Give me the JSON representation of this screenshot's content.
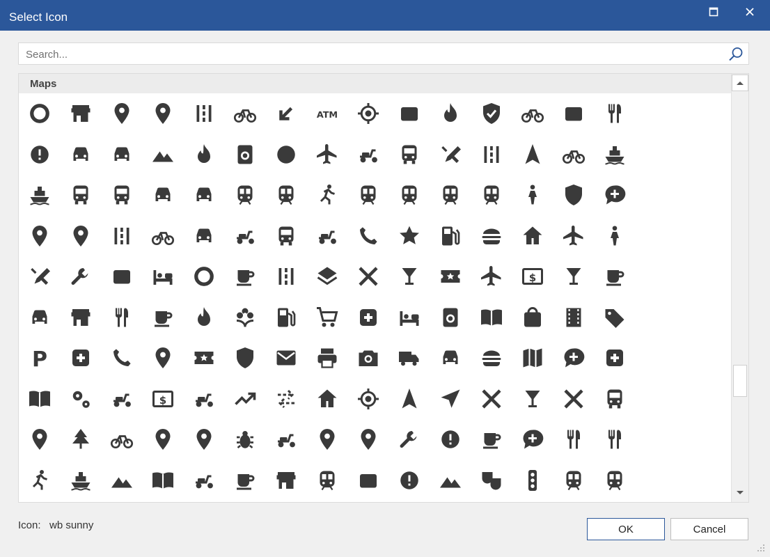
{
  "window": {
    "title": "Select Icon",
    "accent": "#2b579a"
  },
  "search": {
    "placeholder": "Search..."
  },
  "section": {
    "label": "Maps"
  },
  "icons": [
    "360",
    "add business",
    "add location",
    "add location alt",
    "add road",
    "agriculture",
    "alt route",
    "atm",
    "attractions",
    "badge",
    "bakery dining",
    "beenhere",
    "bike scooter",
    "breakfast dining",
    "brunch dining",
    "bus alert",
    "car rental",
    "car repair",
    "category",
    "celebration",
    "cleaning services",
    "compass calibration",
    "connecting airports",
    "delivery dining",
    "departure board",
    "design services",
    "dinner dining",
    "directions",
    "directions bike",
    "directions boat",
    "directions boat filled",
    "directions bus",
    "directions bus filled",
    "directions car",
    "directions car filled",
    "directions railway",
    "directions railway filled",
    "directions run",
    "directions subway",
    "directions subway filled",
    "directions transit",
    "directions transit filled",
    "directions walk",
    "dry cleaning",
    "edit attributes",
    "edit location",
    "edit location alt",
    "edit road",
    "electric bike",
    "electric car",
    "electric moped",
    "electric rickshaw",
    "electric scooter",
    "electrical services",
    "emergency",
    "ev station",
    "fastfood",
    "festival",
    "flight",
    "hail",
    "handyman",
    "hardware",
    "home repair service",
    "hotel",
    "hvac",
    "icecream",
    "kebab dining",
    "layers",
    "layers clear",
    "liquor",
    "local activity",
    "local airport",
    "local atm",
    "local bar",
    "local cafe",
    "local car wash",
    "local convenience store",
    "local dining",
    "local drink",
    "local fire department",
    "local florist",
    "local gas station",
    "local grocery store",
    "local hospital",
    "local hotel",
    "local laundry service",
    "local library",
    "local mall",
    "local movies",
    "local offer",
    "local parking",
    "local pharmacy",
    "local phone",
    "local pizza",
    "local play",
    "local police",
    "local post office",
    "local printshop",
    "local see",
    "local shipping",
    "local taxi",
    "lunch dining",
    "map",
    "maps ugc",
    "medical services",
    "menu book",
    "miscellaneous services",
    "moped",
    "multiple stop",
    "money",
    "moving",
    "near me",
    "pest control",
    "my location",
    "navigation",
    "near me disabled",
    "no drinks",
    "no food",
    "no transfer",
    "not listed location",
    "park",
    "pedal bike",
    "person pin",
    "person pin circle",
    "pest control rodent",
    "pin drop",
    "place",
    "plumbing",
    "railway alert",
    "ramen dining",
    "rate review",
    "restaurant",
    "restaurant menu",
    "run circle",
    "sailing",
    "satellite",
    "set meal",
    "snowmobile",
    "soup kitchen",
    "storefront",
    "streetview",
    "subway",
    "takeout dining",
    "taxi alert",
    "terrain",
    "theater comedy",
    "traffic",
    "train",
    "tram",
    "transfer within a station",
    "transit enterexit",
    "trip origin",
    "two wheeler",
    "volunteer activism",
    "wine bar",
    "wrong location",
    "zoom out map"
  ],
  "footer": {
    "icon_label": "Icon:",
    "icon_value": "wb sunny"
  },
  "buttons": {
    "ok": "OK",
    "cancel": "Cancel"
  }
}
